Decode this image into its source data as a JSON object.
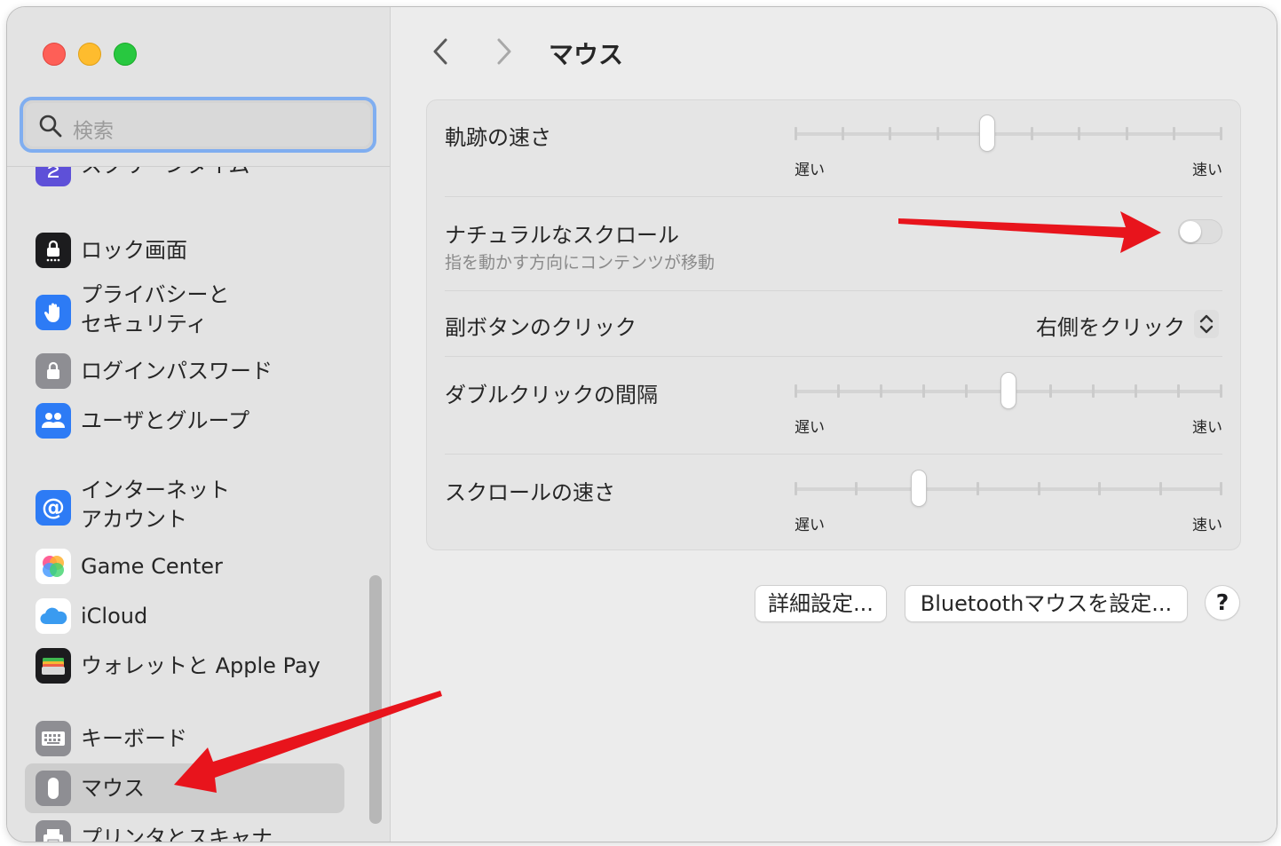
{
  "window": {
    "title": "マウス"
  },
  "search": {
    "placeholder": "検索"
  },
  "sidebar": {
    "items": [
      {
        "label": "スクリーンタイム",
        "icon": "hourglass-icon",
        "color": "#5e50d8"
      },
      {
        "label": "ロック画面",
        "icon": "lock-screen-icon",
        "color": "#1c1c1e"
      },
      {
        "label1": "プライバシーと",
        "label2": "セキュリティ",
        "icon": "hand-icon",
        "color": "#2d7bf5"
      },
      {
        "label": "ログインパスワード",
        "icon": "lock-icon",
        "color": "#8e8e93"
      },
      {
        "label": "ユーザとグループ",
        "icon": "users-icon",
        "color": "#2d7bf5"
      },
      {
        "label1": "インターネット",
        "label2": "アカウント",
        "icon": "at-icon",
        "color": "#2d7bf5"
      },
      {
        "label": "Game Center",
        "icon": "game-center-icon",
        "color": "#ffffff"
      },
      {
        "label": "iCloud",
        "icon": "icloud-icon",
        "color": "#ffffff"
      },
      {
        "label": "ウォレットと Apple Pay",
        "icon": "wallet-icon",
        "color": "#1c1c1e"
      },
      {
        "label": "キーボード",
        "icon": "keyboard-icon",
        "color": "#8e8e93"
      },
      {
        "label": "マウス",
        "icon": "mouse-icon",
        "color": "#8e8e93",
        "selected": true
      },
      {
        "label": "プリンタとスキャナ",
        "icon": "printer-icon",
        "color": "#8e8e93"
      }
    ]
  },
  "nav": {
    "back": "chevron-left-icon",
    "forward": "chevron-right-icon"
  },
  "settings": {
    "tracking_speed": {
      "label": "軌跡の速さ",
      "min_label": "遅い",
      "max_label": "速い",
      "value": 0.45,
      "ticks": 10
    },
    "natural_scroll": {
      "label": "ナチュラルなスクロール",
      "sublabel": "指を動かす方向にコンテンツが移動",
      "enabled": false
    },
    "secondary_click": {
      "label": "副ボタンのクリック",
      "value": "右側をクリック"
    },
    "double_click": {
      "label": "ダブルクリックの間隔",
      "min_label": "遅い",
      "max_label": "速い",
      "value": 0.5,
      "ticks": 11
    },
    "scroll_speed": {
      "label": "スクロールの速さ",
      "min_label": "遅い",
      "max_label": "速い",
      "value": 0.29,
      "ticks": 8
    }
  },
  "buttons": {
    "advanced": "詳細設定...",
    "bluetooth": "Bluetoothマウスを設定...",
    "help": "?"
  },
  "colors": {
    "accent": "#2d7bf5",
    "annotation_arrow": "#e8141c"
  }
}
